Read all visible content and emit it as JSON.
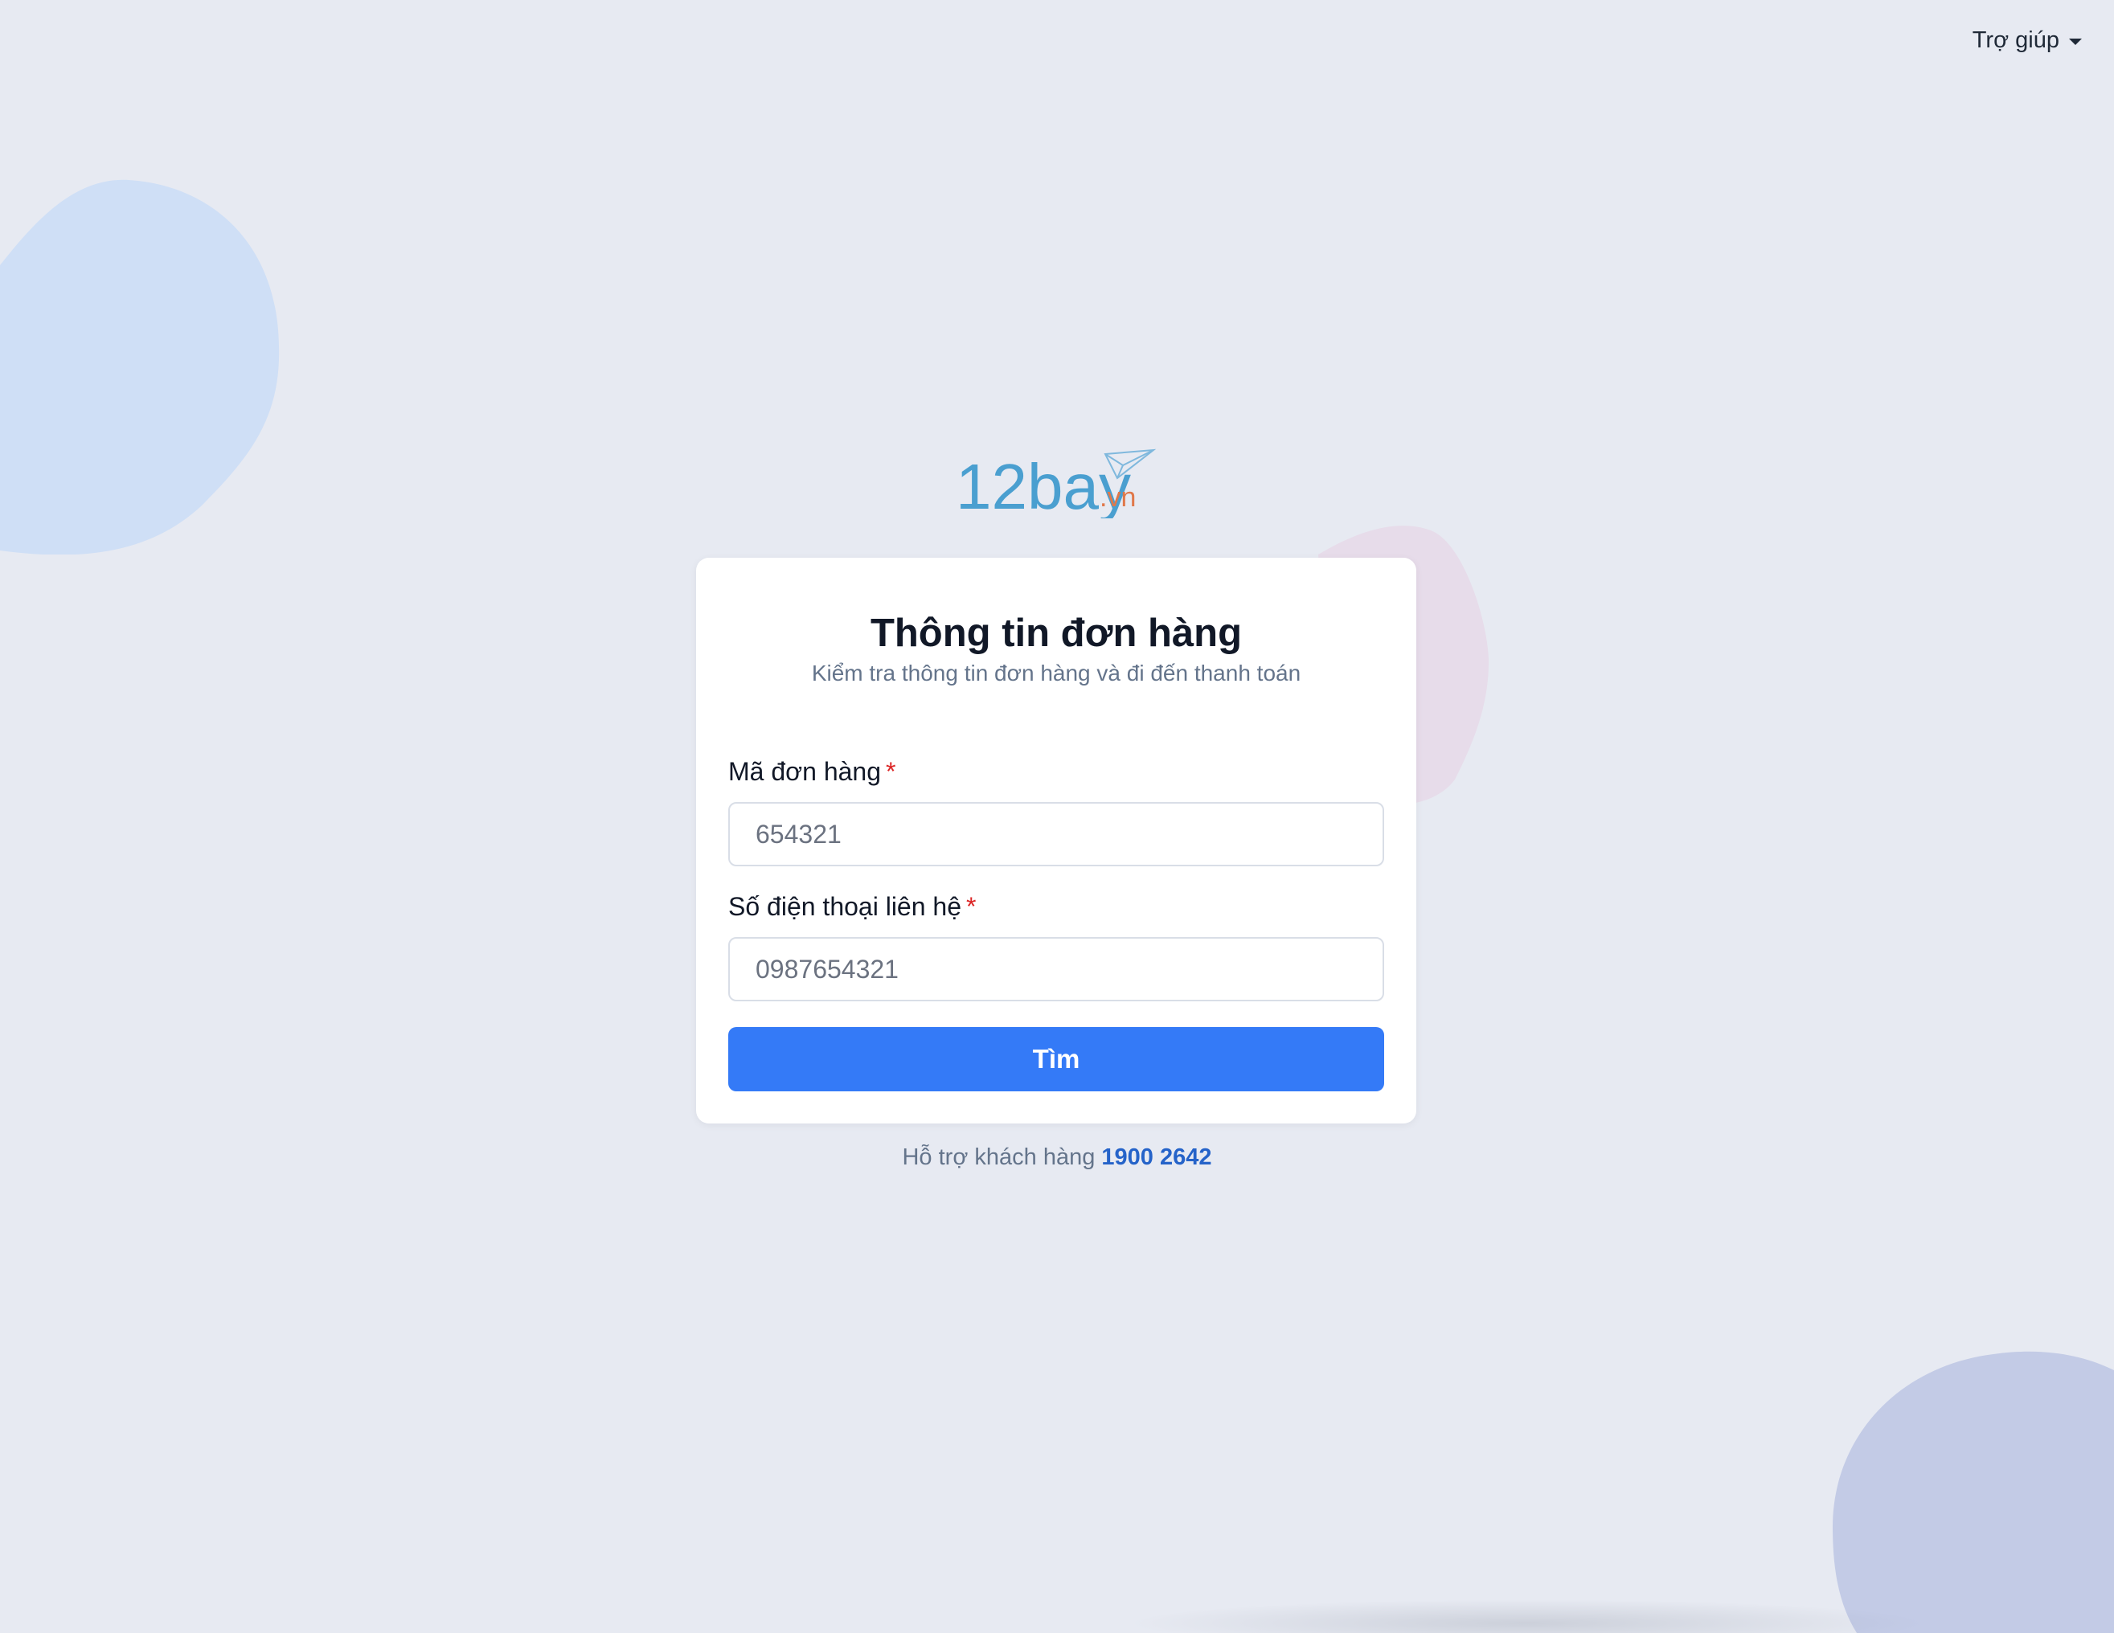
{
  "header": {
    "help_label": "Trợ giúp"
  },
  "logo": {
    "main_text": "12bay",
    "suffix_text": ".vn",
    "main_color": "#4a9fd0",
    "suffix_color": "#e0784a"
  },
  "card": {
    "title": "Thông tin đơn hàng",
    "subtitle": "Kiểm tra thông tin đơn hàng và đi đến thanh toán",
    "order_code": {
      "label": "Mã đơn hàng",
      "required_mark": "*",
      "placeholder": "654321",
      "value": ""
    },
    "phone": {
      "label": "Số điện thoại liên hệ",
      "required_mark": "*",
      "placeholder": "0987654321",
      "value": ""
    },
    "submit_label": "Tìm"
  },
  "support": {
    "text": "Hỗ trợ khách hàng",
    "phone": "1900 2642"
  },
  "colors": {
    "background": "#e7eaf2",
    "primary_button": "#347af7",
    "link": "#2563c9",
    "required": "#dc2626"
  }
}
